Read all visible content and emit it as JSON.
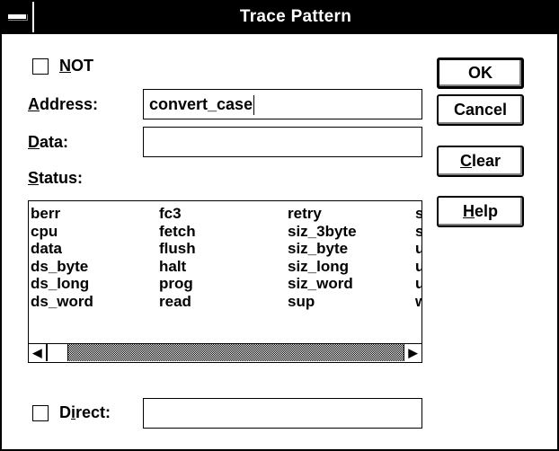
{
  "window": {
    "title": "Trace Pattern"
  },
  "not_checkbox": {
    "label": "NOT",
    "mnemonic": "N",
    "rest": "OT",
    "checked": false
  },
  "address": {
    "label_mnemonic": "A",
    "label_rest": "ddress:",
    "value": "convert_case"
  },
  "data_field": {
    "label_mnemonic": "D",
    "label_rest": "ata:",
    "value": ""
  },
  "status": {
    "label_mnemonic": "S",
    "label_rest": "tatus:"
  },
  "status_list": {
    "columns": [
      [
        "berr",
        "cpu",
        "data",
        "ds_byte",
        "ds_long",
        "ds_word"
      ],
      [
        "fc3",
        "fetch",
        "flush",
        "halt",
        "prog",
        "read"
      ],
      [
        "retry",
        "siz_3byte",
        "siz_byte",
        "siz_long",
        "siz_word",
        "sup"
      ],
      [
        "s",
        "s",
        "u",
        "u",
        "u",
        "w"
      ]
    ],
    "scroll_position": 0.0
  },
  "direct_checkbox": {
    "label_pre": "D",
    "label_mnemonic": "i",
    "label_rest": "rect:",
    "checked": false,
    "value": ""
  },
  "buttons": {
    "ok": "OK",
    "cancel": "Cancel",
    "clear_mnemonic": "C",
    "clear_rest": "lear",
    "help_mnemonic": "H",
    "help_rest": "elp"
  }
}
